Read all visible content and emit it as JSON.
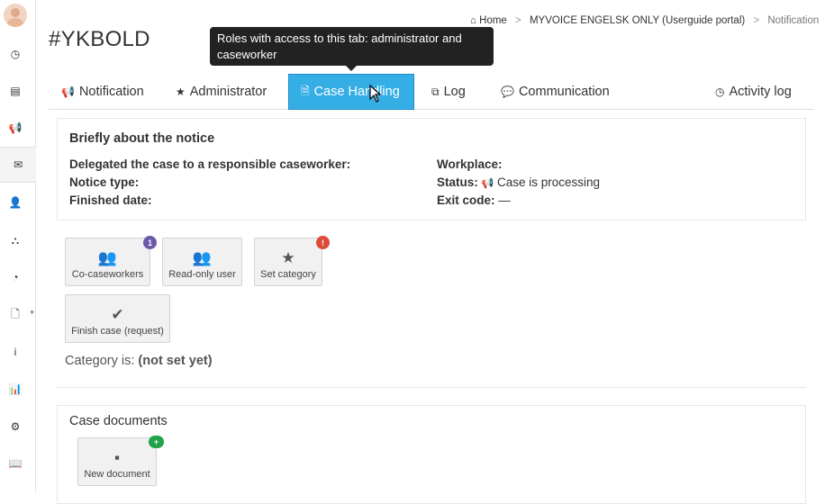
{
  "breadcrumb": {
    "home": "Home",
    "portal": "MYVOICE ENGELSK ONLY (Userguide portal)",
    "current": "Notification"
  },
  "page_title": "#YKBOLD",
  "tooltip": "Roles with access to this tab: administrator and caseworker",
  "tabs": [
    {
      "label": "Notification",
      "icon": "bullhorn-icon"
    },
    {
      "label": "Administrator",
      "icon": "star-icon"
    },
    {
      "label": "Case Handling",
      "icon": "file-text-icon"
    },
    {
      "label": "Log",
      "icon": "files-icon"
    },
    {
      "label": "Communication",
      "icon": "comments-icon"
    },
    {
      "label": "Activity log",
      "icon": "clock-icon"
    }
  ],
  "notice": {
    "title": "Briefly about the notice",
    "delegated_label": "Delegated the case to a responsible caseworker:",
    "notice_type_label": "Notice type:",
    "finished_label": "Finished date:",
    "workplace_label": "Workplace:",
    "status_label": "Status:",
    "status_value": "Case is processing",
    "exit_code_label": "Exit code:",
    "exit_code_value": "—"
  },
  "actions": {
    "co_caseworkers": "Co-caseworkers",
    "co_caseworkers_badge": "1",
    "read_only_user": "Read-only user",
    "set_category": "Set category",
    "set_category_badge": "!",
    "finish_case": "Finish case (request)"
  },
  "category": {
    "label": "Category is:",
    "value": "(not set yet)"
  },
  "documents": {
    "title": "Case documents",
    "new_document": "New document",
    "new_badge": "+"
  },
  "colors": {
    "active_tab": "#35aee5",
    "badge_purple": "#6a5aa8",
    "badge_red": "#dd4b39",
    "badge_green": "#1fa24a"
  }
}
